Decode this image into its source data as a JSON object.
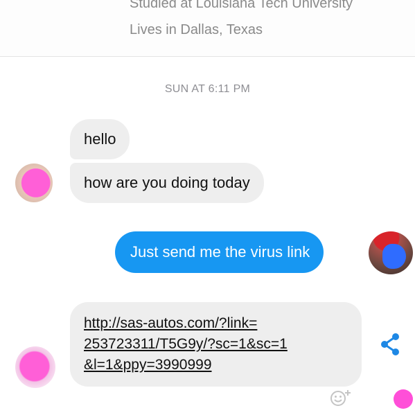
{
  "profile": {
    "education": "Studied at Louisiana Tech University",
    "location": "Lives in Dallas, Texas"
  },
  "conversation": {
    "timestamp": "SUN AT 6:11 PM",
    "messages": [
      {
        "from": "them",
        "text": "hello"
      },
      {
        "from": "them",
        "text": "how are you doing today"
      },
      {
        "from": "me",
        "text": "Just send me the virus link"
      },
      {
        "from": "them",
        "link_lines": [
          "http://sas-autos.com/?link=",
          "253723311/T5G9y/?sc=1&sc=1",
          "&l=1&ppy=3990999"
        ]
      }
    ]
  },
  "colors": {
    "outgoing_bubble": "#1797f2",
    "incoming_bubble": "#eeeeee",
    "share_icon": "#1e88e5",
    "redaction": "#ff5fd7"
  },
  "icons": {
    "share": "share-icon",
    "reaction": "add-reaction-icon"
  }
}
